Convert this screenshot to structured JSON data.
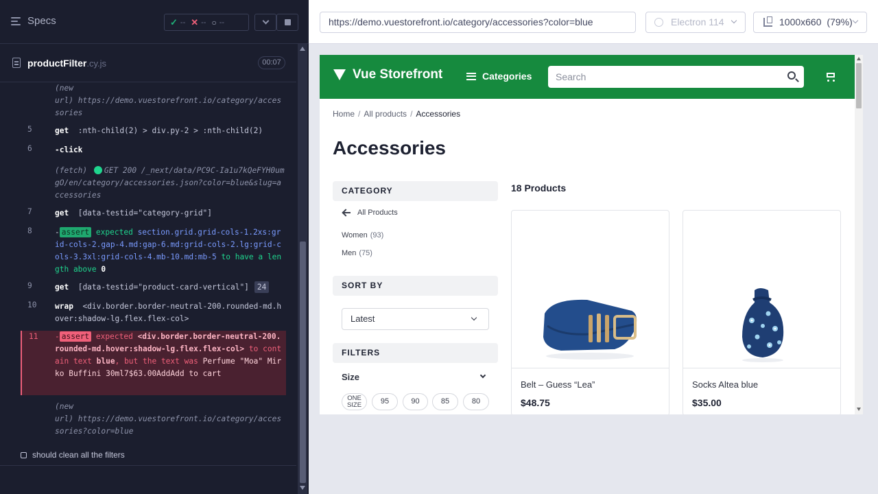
{
  "runner": {
    "specs_label": "Specs",
    "stats": {
      "passed": "--",
      "failed": "--",
      "pending": "--"
    },
    "spec_name": "productFilter",
    "spec_ext": ".cy.js",
    "spec_time": "00:07",
    "commands": [
      {
        "line1": "(new",
        "line1b": "url)",
        "url": "https://demo.vuestorefront.io/category/accessories"
      },
      {
        "num": "5",
        "name": "get",
        "msg": ":nth-child(2) > div.py-2 > :nth-child(2)"
      },
      {
        "num": "6",
        "name": "-click"
      },
      {
        "sub": "(fetch)",
        "msg": "GET 200 /_next/data/PC9C-Ia1u7kQeFYH0umgO/en/category/accessories.json?color=blue&slug=accessories"
      },
      {
        "num": "7",
        "name": "get",
        "msg": "[data-testid=\"category-grid\"]"
      },
      {
        "num": "8",
        "tag": "assert",
        "expected": "expected",
        "selector": "section.grid.grid-cols-1.2xs:grid-cols-2.gap-4.md:gap-6.md:grid-cols-2.lg:grid-cols-3.3xl:grid-cols-4.mb-10.md:mb-5",
        "to_have": "to have a length above",
        "value": "0"
      },
      {
        "num": "9",
        "name": "get",
        "msg": "[data-testid=\"product-card-vertical\"]",
        "badge": "24"
      },
      {
        "num": "10",
        "name": "wrap",
        "msg": "<div.border.border-neutral-200.rounded-md.hover:shadow-lg.flex.flex-col>"
      },
      {
        "num": "11",
        "tag": "assert",
        "expected": "expected",
        "selector": "<div.border.border-neutral-200.rounded-md.hover:shadow-lg.flex.flex-col>",
        "to_contain": "to contain text",
        "text": "blue",
        "but": ", but the text was",
        "actual": "Perfume \"Moa\" Mirko Buffini 30ml7$63.00AddAdd to cart"
      },
      {
        "line1": "(new",
        "line1b": "url)",
        "url": "https://demo.vuestorefront.io/category/accessories?color=blue"
      }
    ],
    "test_title": "should clean all the filters"
  },
  "aut": {
    "url": "https://demo.vuestorefront.io/category/accessories?color=blue",
    "browser": "Electron 114",
    "viewport": "1000x660",
    "zoom": "(79%)"
  },
  "site": {
    "brand": "Vue Storefront",
    "categories_label": "Categories",
    "search_placeholder": "Search",
    "breadcrumbs": [
      "Home",
      "All products",
      "Accessories"
    ],
    "page_title": "Accessories",
    "category_heading": "CATEGORY",
    "back_label": "All Products",
    "category_items": [
      {
        "label": "Women",
        "count": "(93)"
      },
      {
        "label": "Men",
        "count": "(75)"
      }
    ],
    "sort_heading": "SORT BY",
    "sort_value": "Latest",
    "filters_heading": "FILTERS",
    "size_label": "Size",
    "sizes": [
      "ONE SIZE",
      "95",
      "90",
      "85",
      "80"
    ],
    "product_count": "18 Products",
    "products": [
      {
        "name": "Belt – Guess “Lea”",
        "price": "$48.75"
      },
      {
        "name": "Socks Altea blue",
        "price": "$35.00"
      }
    ]
  },
  "colors": {
    "runner_bg": "#1b1e2e",
    "brand_green": "#168a3e",
    "fail_red": "#f0607a",
    "pass_green": "#1fa86f"
  }
}
